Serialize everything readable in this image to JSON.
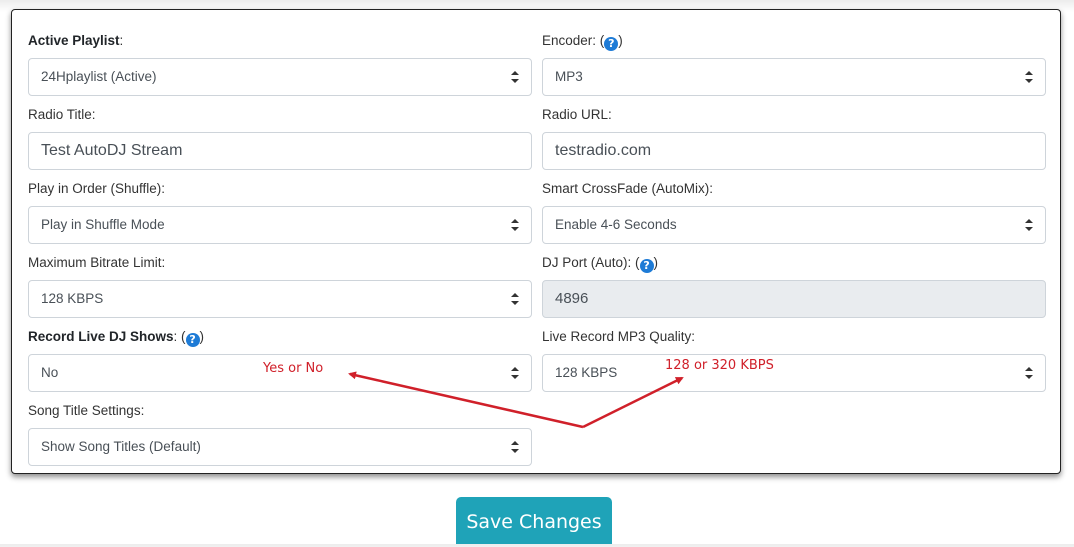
{
  "form": {
    "active_playlist": {
      "label": "Active Playlist",
      "colon": ":",
      "value": "24Hplaylist (Active)"
    },
    "encoder": {
      "label": "Encoder: (",
      "close": ")",
      "value": "MP3"
    },
    "radio_title": {
      "label": "Radio Title:",
      "value": "Test AutoDJ Stream"
    },
    "radio_url": {
      "label": "Radio URL:",
      "value": "testradio.com"
    },
    "play_order": {
      "label": "Play in Order (Shuffle):",
      "value": "Play in Shuffle Mode"
    },
    "crossfade": {
      "label": "Smart CrossFade (AutoMix):",
      "value": "Enable 4-6 Seconds"
    },
    "max_bitrate": {
      "label": "Maximum Bitrate Limit:",
      "value": "128 KBPS"
    },
    "dj_port": {
      "label": "DJ Port (Auto): (",
      "close": ")",
      "value": "4896"
    },
    "record_live": {
      "label": "Record Live DJ Shows",
      "colon": ": (",
      "close": ")",
      "value": "No"
    },
    "record_quality": {
      "label": "Live Record MP3 Quality:",
      "value": "128 KBPS"
    },
    "song_title": {
      "label": "Song Title Settings:",
      "value": "Show Song Titles (Default)"
    }
  },
  "help_icon_glyph": "?",
  "annotations": {
    "record_hint": "Yes or No",
    "quality_hint": "128 or 320 KBPS",
    "color": "#d0202a"
  },
  "save_button": {
    "label": "Save Changes",
    "color": "#1fa3b8"
  }
}
